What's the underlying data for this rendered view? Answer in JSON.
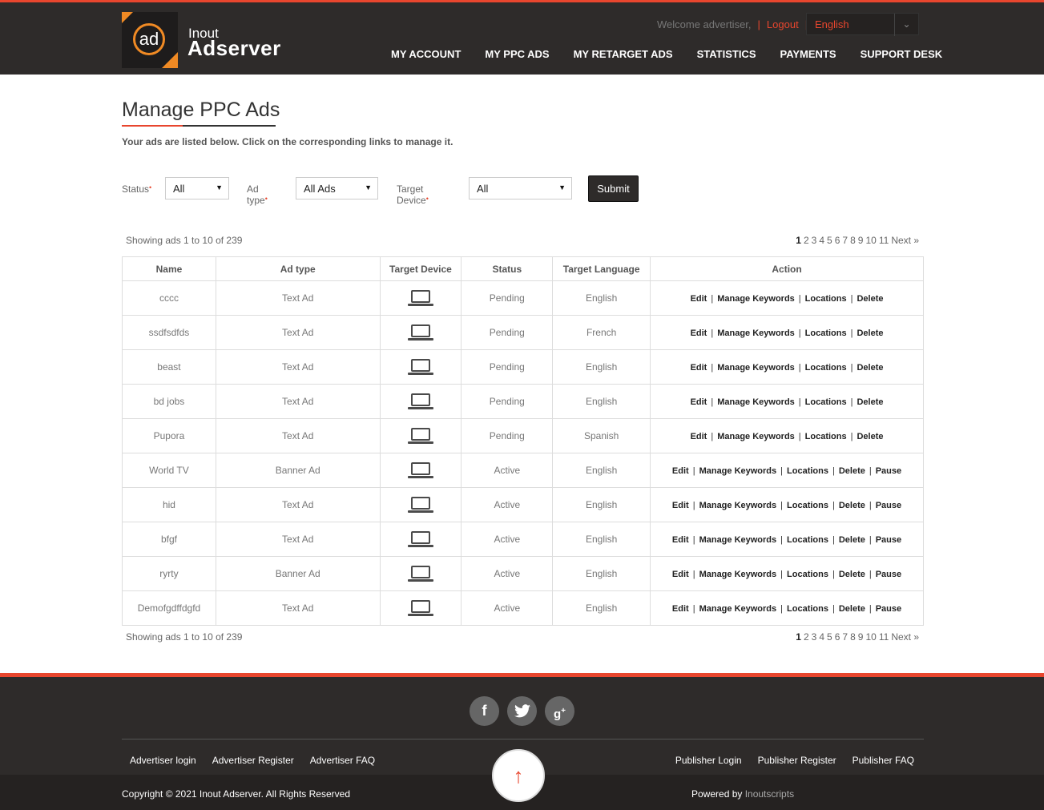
{
  "brand": {
    "logo_mark": "ad",
    "small": "Inout",
    "big": "Adserver"
  },
  "topbar": {
    "welcome": "Welcome advertiser,",
    "logout": "Logout",
    "language": "English"
  },
  "nav": [
    "MY ACCOUNT",
    "MY PPC ADS",
    "MY RETARGET ADS",
    "STATISTICS",
    "PAYMENTS",
    "SUPPORT DESK"
  ],
  "page": {
    "title": "Manage PPC Ads",
    "intro": "Your ads are listed below. Click on the corresponding links to manage it."
  },
  "filters": {
    "status_label": "Status",
    "status_value": "All",
    "adtype_label": "Ad type",
    "adtype_value": "All Ads",
    "device_label": "Target Device",
    "device_value": "All",
    "submit": "Submit"
  },
  "listing": {
    "showing": "Showing ads 1 to 10 of 239",
    "pages": [
      "1",
      "2",
      "3",
      "4",
      "5",
      "6",
      "7",
      "8",
      "9",
      "10",
      "11"
    ],
    "current_page": "1",
    "next": "Next »"
  },
  "table": {
    "headers": [
      "Name",
      "Ad type",
      "Target Device",
      "Status",
      "Target Language",
      "Action"
    ],
    "rows": [
      {
        "name": "cccc",
        "type": "Text Ad",
        "device": "laptop-icon",
        "status": "Pending",
        "language": "English",
        "actions": [
          "Edit",
          "Manage Keywords",
          "Locations",
          "Delete"
        ]
      },
      {
        "name": "ssdfsdfds",
        "type": "Text Ad",
        "device": "laptop-icon",
        "status": "Pending",
        "language": "French",
        "actions": [
          "Edit",
          "Manage Keywords",
          "Locations",
          "Delete"
        ]
      },
      {
        "name": "beast",
        "type": "Text Ad",
        "device": "laptop-icon",
        "status": "Pending",
        "language": "English",
        "actions": [
          "Edit",
          "Manage Keywords",
          "Locations",
          "Delete"
        ]
      },
      {
        "name": "bd jobs",
        "type": "Text Ad",
        "device": "laptop-icon",
        "status": "Pending",
        "language": "English",
        "actions": [
          "Edit",
          "Manage Keywords",
          "Locations",
          "Delete"
        ]
      },
      {
        "name": "Pupora",
        "type": "Text Ad",
        "device": "laptop-icon",
        "status": "Pending",
        "language": "Spanish",
        "actions": [
          "Edit",
          "Manage Keywords",
          "Locations",
          "Delete"
        ]
      },
      {
        "name": "World TV",
        "type": "Banner Ad",
        "device": "laptop-icon",
        "status": "Active",
        "language": "English",
        "actions": [
          "Edit",
          "Manage Keywords",
          "Locations",
          "Delete",
          "Pause"
        ]
      },
      {
        "name": "hid",
        "type": "Text Ad",
        "device": "laptop-icon",
        "status": "Active",
        "language": "English",
        "actions": [
          "Edit",
          "Manage Keywords",
          "Locations",
          "Delete",
          "Pause"
        ]
      },
      {
        "name": "bfgf",
        "type": "Text Ad",
        "device": "laptop-icon",
        "status": "Active",
        "language": "English",
        "actions": [
          "Edit",
          "Manage Keywords",
          "Locations",
          "Delete",
          "Pause"
        ]
      },
      {
        "name": "ryrty",
        "type": "Banner Ad",
        "device": "laptop-icon",
        "status": "Active",
        "language": "English",
        "actions": [
          "Edit",
          "Manage Keywords",
          "Locations",
          "Delete",
          "Pause"
        ]
      },
      {
        "name": "Demofgdffdgfd",
        "type": "Text Ad",
        "device": "laptop-icon",
        "status": "Active",
        "language": "English",
        "actions": [
          "Edit",
          "Manage Keywords",
          "Locations",
          "Delete",
          "Pause"
        ]
      }
    ]
  },
  "footer": {
    "social": [
      "facebook-icon",
      "twitter-icon",
      "google-plus-icon"
    ],
    "left_links": [
      "Advertiser login",
      "Advertiser Register",
      "Advertiser FAQ"
    ],
    "right_links": [
      "Publisher Login",
      "Publisher Register",
      "Publisher FAQ"
    ],
    "copyright": "Copyright © 2021 Inout Adserver. All Rights Reserved",
    "powered_prefix": "Powered by ",
    "powered_brand": "Inoutscripts",
    "to_top": "↑"
  },
  "colors": {
    "accent": "#e8462e",
    "logo_orange": "#f08a24",
    "header_bg": "#2e2b2a"
  }
}
